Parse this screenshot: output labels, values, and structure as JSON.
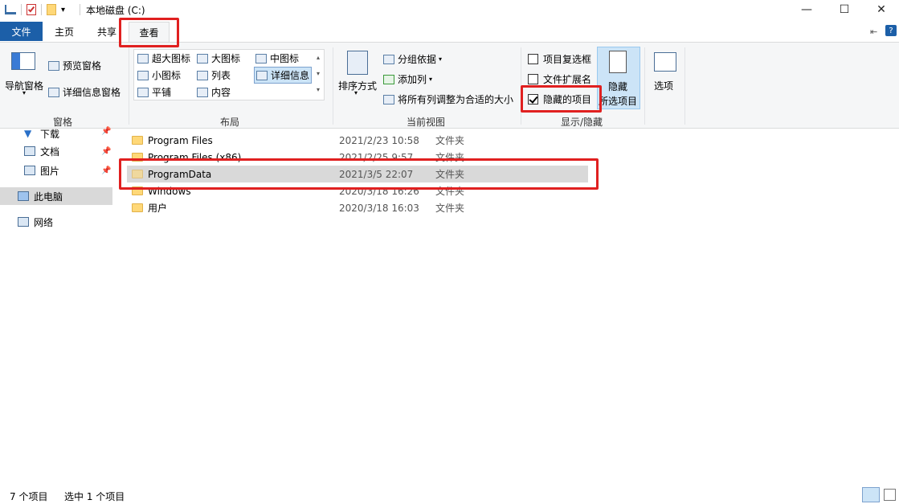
{
  "window": {
    "title": "本地磁盘 (C:)",
    "minimize_glyph": "—",
    "maximize_glyph": "☐",
    "close_glyph": "✕"
  },
  "tabs": {
    "file": "文件",
    "home": "主页",
    "share": "共享",
    "view": "查看"
  },
  "ribbon": {
    "panes": {
      "nav_pane": "导航窗格",
      "preview_pane": "预览窗格",
      "details_pane": "详细信息窗格",
      "group": "窗格"
    },
    "layout": {
      "items": [
        "超大图标",
        "大图标",
        "中图标",
        "小图标",
        "列表",
        "详细信息",
        "平铺",
        "内容"
      ],
      "group": "布局"
    },
    "current_view": {
      "sort": "排序方式",
      "group_by": "分组依据",
      "add_column": "添加列",
      "fit_columns": "将所有列调整为合适的大小",
      "group": "当前视图"
    },
    "show_hide": {
      "item_checkboxes": "项目复选框",
      "file_extensions": "文件扩展名",
      "hidden_items": "隐藏的项目",
      "hide_selected_line1": "隐藏",
      "hide_selected_line2": "所选项目",
      "group": "显示/隐藏"
    },
    "options": "选项"
  },
  "nav": {
    "items": [
      "下载",
      "文档",
      "图片",
      "此电脑",
      "网络"
    ]
  },
  "files": [
    {
      "name": "Program Files",
      "date": "2021/2/23 10:58",
      "type": "文件夹"
    },
    {
      "name": "Program Files (x86)",
      "date": "2021/2/25 9:57",
      "type": "文件夹"
    },
    {
      "name": "ProgramData",
      "date": "2021/3/5 22:07",
      "type": "文件夹"
    },
    {
      "name": "Windows",
      "date": "2020/3/18 16:26",
      "type": "文件夹"
    },
    {
      "name": "用户",
      "date": "2020/3/18 16:03",
      "type": "文件夹"
    }
  ],
  "status": {
    "count": "7 个项目",
    "selected": "选中 1 个项目"
  },
  "colors": {
    "file_tab": "#1c5fa8",
    "highlight": "#e02020",
    "selection": "#d9d9d9"
  }
}
